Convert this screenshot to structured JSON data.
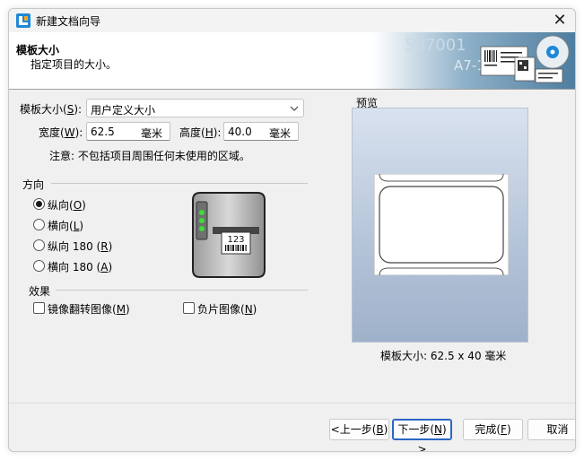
{
  "window": {
    "title": "新建文档向导",
    "close_glyph": "✕"
  },
  "header": {
    "title": "模板大小",
    "subtitle": "指定项目的大小。",
    "art_text_1": "597001",
    "art_text_2": "A7-118"
  },
  "template_size": {
    "label": "模板大小(",
    "accel": "S",
    "label_end": "):",
    "value": "用户定义大小"
  },
  "width": {
    "label": "宽度(",
    "accel": "W",
    "label_end": "):",
    "value": "62.5",
    "unit": "毫米"
  },
  "height": {
    "label": "高度(",
    "accel": "H",
    "label_end": "):",
    "value": "40.0",
    "unit": "毫米"
  },
  "note": "注意: 不包括项目周围任何未使用的区域。",
  "orientation": {
    "title": "方向",
    "options": [
      {
        "text": "纵向(",
        "accel": "O",
        "end": ")",
        "checked": true
      },
      {
        "text": "横向(",
        "accel": "L",
        "end": ")",
        "checked": false
      },
      {
        "text": "纵向 180 (",
        "accel": "R",
        "end": ")",
        "checked": false
      },
      {
        "text": "横向 180 (",
        "accel": "A",
        "end": ")",
        "checked": false
      }
    ]
  },
  "printer": {
    "label_number": "123"
  },
  "effects": {
    "title": "效果",
    "mirror": {
      "text": "镜像翻转图像(",
      "accel": "M",
      "end": ")"
    },
    "negative": {
      "text": "负片图像(",
      "accel": "N",
      "end": ")"
    }
  },
  "preview": {
    "title": "预览",
    "caption": "模板大小:  62.5 x 40 毫米"
  },
  "buttons": {
    "back": {
      "text": "<上一步(",
      "accel": "B",
      "end": ")"
    },
    "next": {
      "text": "下一步(",
      "accel": "N",
      "end": ") >"
    },
    "finish": {
      "text": "完成(",
      "accel": "F",
      "end": ")"
    },
    "cancel": "取消"
  },
  "colors": {
    "accent": "#2a66c4",
    "preview_top": "#d8e2ef",
    "preview_bottom": "#9fb1ca"
  }
}
